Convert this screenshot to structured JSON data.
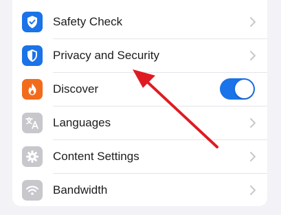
{
  "colors": {
    "blue_icon": "#1a73e8",
    "orange_icon": "#f26b1d",
    "gray_icon": "#c7c7cc",
    "toggle_on": "#1a73e8",
    "arrow": "#e01a22"
  },
  "settings": {
    "items": [
      {
        "label": "Safety Check",
        "icon": "shield-check-icon",
        "control": "chevron"
      },
      {
        "label": "Privacy and Security",
        "icon": "shield-icon",
        "control": "chevron"
      },
      {
        "label": "Discover",
        "icon": "flame-icon",
        "control": "toggle",
        "toggle_on": true
      },
      {
        "label": "Languages",
        "icon": "translate-icon",
        "control": "chevron"
      },
      {
        "label": "Content Settings",
        "icon": "gear-icon",
        "control": "chevron"
      },
      {
        "label": "Bandwidth",
        "icon": "wifi-icon",
        "control": "chevron"
      }
    ]
  }
}
